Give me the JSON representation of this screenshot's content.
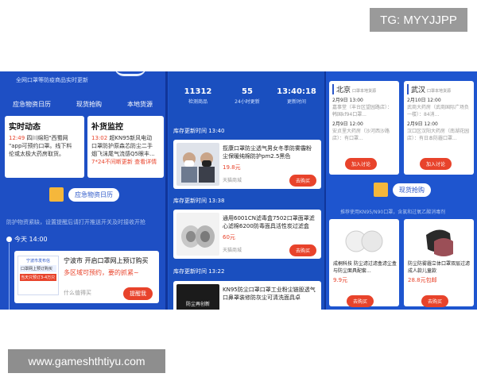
{
  "tg_label": "TG: MYYJJPP",
  "watermark": "www.gameshthtiyu.com",
  "left": {
    "subtitle": "全网口罩等防疫商品实时更新",
    "tabs": [
      "应急物资日历",
      "现货抢购",
      "本地货源"
    ],
    "news": {
      "title": "实时动态",
      "lines": [
        {
          "time": "12:49",
          "text": "四川绵阳\"西蜀网"
        },
        {
          "time": "",
          "text": "\"app可预约口罩。线下料"
        },
        {
          "time": "",
          "text": "伦或太极大药房取货。"
        }
      ]
    },
    "supply": {
      "title": "补货监控",
      "lines": [
        {
          "time": "13:02",
          "text": "超KN95新风电动"
        },
        {
          "time": "",
          "text": "口罩防护原森芯防尘二手"
        },
        {
          "time": "",
          "text": "烟飞沫尾气流感Q5眼丰..."
        }
      ],
      "footer_left": "7*24不间断更新",
      "footer_right": "查看详情"
    },
    "calendar_title": "应急物资日历",
    "hint": "防护物资紧缺，设置提醒后请打开推送开关及时接收开抢",
    "today": "今天 14:00",
    "event": {
      "img_header": "宁波市发布信",
      "img_line1": "口罩网上预订购买",
      "img_line2": "当天只预订3-4万只",
      "title": "宁波市 开启口罩网上预订购买",
      "sub": "多区域可预约，要的抓紧~",
      "note": "什么值得买",
      "button": "提醒我"
    }
  },
  "middle": {
    "stats": [
      {
        "value": "11312",
        "label": "检测商品"
      },
      {
        "value": "55",
        "label": "24小时更新"
      },
      {
        "value": "13:40:18",
        "label": "更新时间"
      }
    ],
    "sections": [
      {
        "header": "库存更新时间 13:40",
        "title": "揽康口罩防尘透气男女冬季防雾霾粉尘保暖纯棉防护pm2.5黑色",
        "price": "19.8元",
        "shop": "天猫商城",
        "button": "去购买"
      },
      {
        "header": "库存更新时间 13:38",
        "title": "通用6001CN滤毒盒7502口罩面罩滤心滤棉6200防毒面具活性炭过滤盒",
        "price": "60元",
        "shop": "天猫商城",
        "button": "去购买"
      },
      {
        "header": "库存更新时间 13:22",
        "title": "KN95防尘口罩口罩工业粉尘链股透气口鼻罩装修防灰尘可清洗面具卓",
        "price": "",
        "shop": "",
        "button": "",
        "img_text": "防尘再创新"
      }
    ]
  },
  "right": {
    "cities": [
      {
        "name": "北京",
        "subtitle": "口罩本地货源",
        "items": [
          {
            "title": "2月9日 13:00",
            "text": "嘉事堂（丰台区望园路店）：韩国kf94口罩..."
          },
          {
            "title": "2月9日 12:00",
            "text": "安贞里大药房（沙河西沙路店）：有口罩..."
          }
        ],
        "button": "加入讨论"
      },
      {
        "name": "武汉",
        "subtitle": "口罩本地货源",
        "items": [
          {
            "title": "2月10日 12:00",
            "text": "武商大药房（武商国际广场负一楼）：84消..."
          },
          {
            "title": "2月9日 12:00",
            "text": "汉口区汉阳大药房（南湖花园店）：有日本防霾口罩..."
          }
        ],
        "button": "加入讨论"
      }
    ],
    "spot_title": "现货抢购",
    "hint": "推荐使用KN95/N90口罩，含氯和过氧乙酸消毒剂",
    "goods": [
      {
        "title": "成桐科技 防尘滤过滤盒滤尘盒 与防尘面具配套...",
        "price": "9.9元",
        "button": "去购买"
      },
      {
        "title": "防尘防雾霾立体口罩双层过滤成人款儿童款",
        "price": "28.8元包邮",
        "button": "去购买"
      }
    ]
  },
  "colors": {
    "blue_bg": "#1e55cf",
    "accent_red": "#e8432b",
    "accent_yellow": "#f5b73b"
  }
}
